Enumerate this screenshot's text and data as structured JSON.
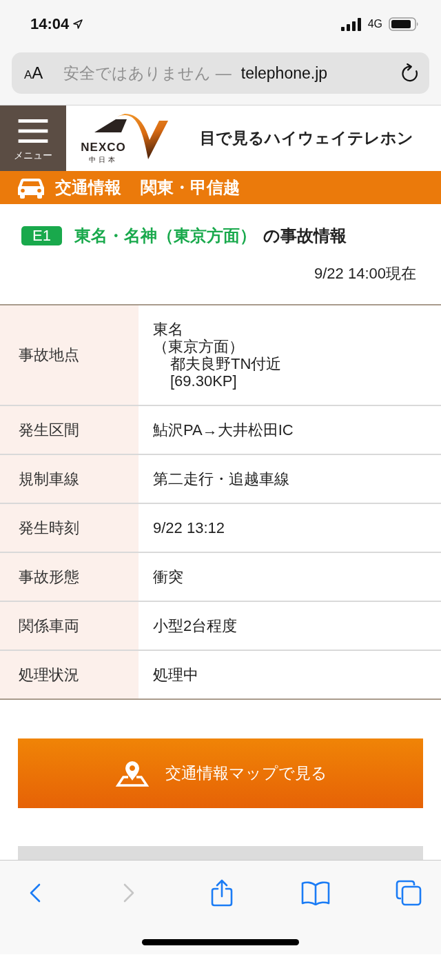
{
  "status_bar": {
    "time": "14:04",
    "network": "4G"
  },
  "address_bar": {
    "text_size_label": "AA",
    "security_notice": "安全ではありません —",
    "domain": "telephone.jp"
  },
  "header": {
    "menu_label": "メニュー",
    "logo_wordmark": "NEXCO",
    "logo_subtitle": "中日本",
    "site_title": "目で見るハイウェイテレホン"
  },
  "section_bar": {
    "category": "交通情報",
    "region": "関東・甲信越"
  },
  "incident": {
    "route_badge": "E1",
    "route_name": "東名・名神（東京方面）",
    "title_suffix": "の事故情報",
    "timestamp": "9/22 14:00現在"
  },
  "details": [
    {
      "label": "事故地点",
      "lines": [
        {
          "text": "東名"
        },
        {
          "text": "（東京方面）",
          "children": [
            {
              "text": "都夫良野TN付近"
            },
            {
              "text": "[69.30KP]"
            }
          ]
        }
      ]
    },
    {
      "label": "発生区間",
      "value": "鮎沢PA→大井松田IC"
    },
    {
      "label": "規制車線",
      "value": "第二走行・追越車線"
    },
    {
      "label": "発生時刻",
      "value": "9/22 13:12"
    },
    {
      "label": "事故形態",
      "value": "衝突"
    },
    {
      "label": "関係車両",
      "value": "小型2台程度"
    },
    {
      "label": "処理状況",
      "value": "処理中"
    }
  ],
  "map_button": "交通情報マップで見る",
  "toolbar": [
    {
      "kind": "back",
      "disabled": false
    },
    {
      "kind": "forward",
      "disabled": true
    },
    {
      "kind": "share",
      "disabled": false
    },
    {
      "kind": "bookmarks",
      "disabled": false
    },
    {
      "kind": "tabs",
      "disabled": false
    }
  ]
}
